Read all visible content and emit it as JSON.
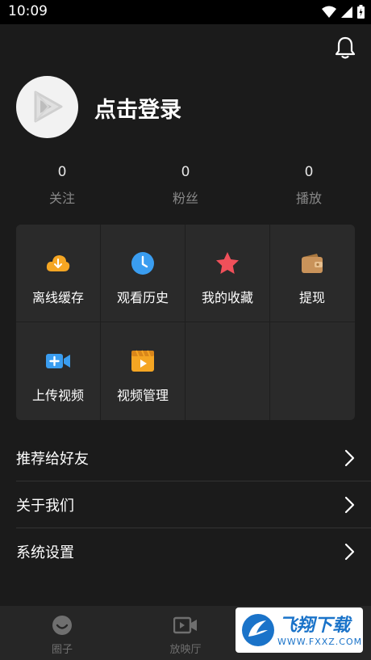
{
  "status_bar": {
    "time": "10:09"
  },
  "profile": {
    "login_text": "点击登录"
  },
  "stats": [
    {
      "value": "0",
      "label": "关注"
    },
    {
      "value": "0",
      "label": "粉丝"
    },
    {
      "value": "0",
      "label": "播放"
    }
  ],
  "features": [
    {
      "label": "离线缓存",
      "icon": "cloud-download-icon",
      "color": "#f5a623"
    },
    {
      "label": "观看历史",
      "icon": "clock-icon",
      "color": "#3a9df0"
    },
    {
      "label": "我的收藏",
      "icon": "star-icon",
      "color": "#f0505a"
    },
    {
      "label": "提现",
      "icon": "wallet-icon",
      "color": "#c9935a"
    },
    {
      "label": "上传视频",
      "icon": "video-upload-icon",
      "color": "#3a9df0"
    },
    {
      "label": "视频管理",
      "icon": "video-manage-icon",
      "color": "#f5a623"
    }
  ],
  "menu": [
    {
      "label": "推荐给好友"
    },
    {
      "label": "关于我们"
    },
    {
      "label": "系统设置"
    }
  ],
  "bottom_nav": [
    {
      "label": "圈子",
      "icon": "smile-icon"
    },
    {
      "label": "放映厅",
      "icon": "video-camera-icon"
    }
  ],
  "watermark": {
    "title": "飞翔下载",
    "url": "WWW.FXXZ.COM"
  }
}
